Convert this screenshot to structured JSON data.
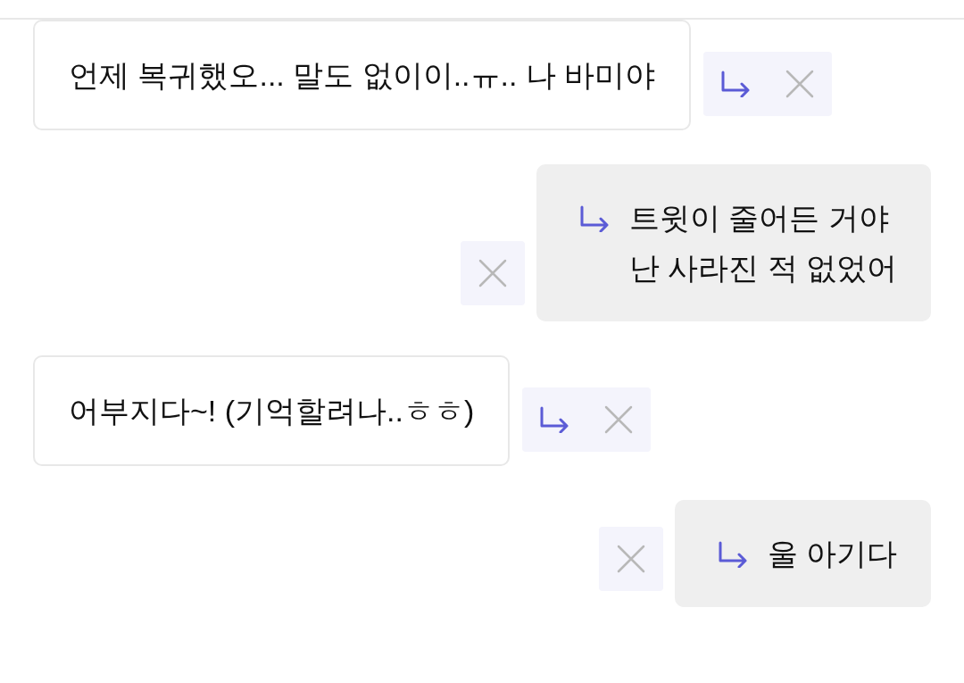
{
  "messages": [
    {
      "kind": "received",
      "text": "언제 복귀했오... 말도 없이이..ㅠ.. 나 바미야"
    },
    {
      "kind": "sent",
      "text": "트윗이 줄어든 거야\n난 사라진 적 없었어"
    },
    {
      "kind": "received",
      "text": "어부지다~! (기억할려나..ㅎㅎ)"
    },
    {
      "kind": "sent",
      "text": "울 아기다"
    }
  ]
}
